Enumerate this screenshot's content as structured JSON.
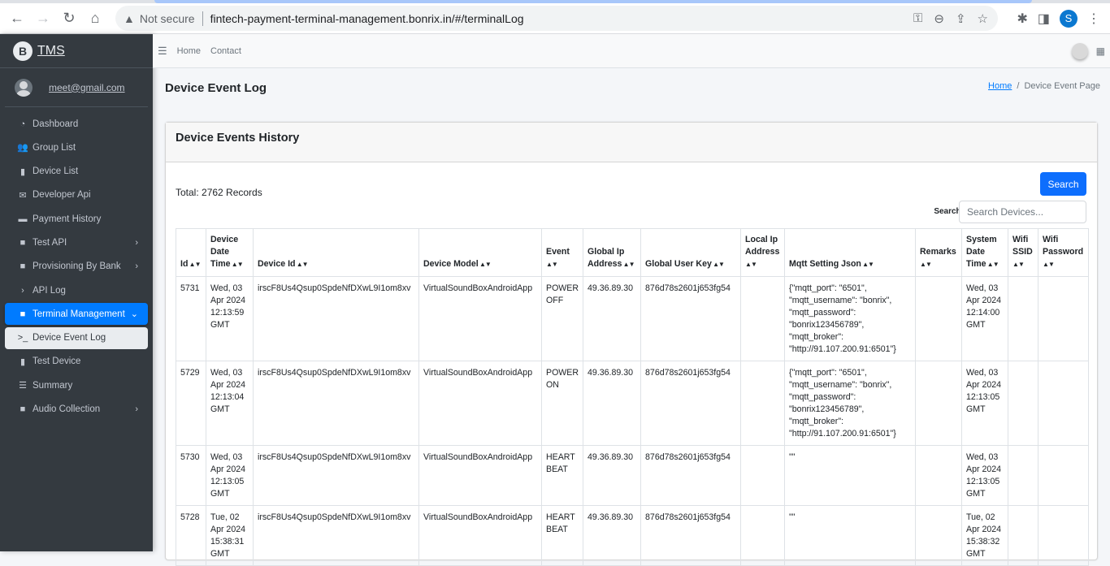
{
  "browser": {
    "not_secure_label": "Not secure",
    "url": "fintech-payment-terminal-management.bonrix.in/#/terminalLog",
    "profile_initial": "S",
    "icons": [
      "back-icon",
      "forward-icon",
      "reload-icon",
      "home-icon",
      "warning-icon",
      "key-icon",
      "zoom-out-icon",
      "share-icon",
      "star-icon",
      "extensions-icon",
      "sidepanel-icon",
      "menu-icon"
    ]
  },
  "sidebar": {
    "brand": "TMS",
    "brand_logo": "B",
    "user_email": "meet@gmail.com",
    "items": [
      {
        "label": "Dashboard",
        "icon": "tachometer-icon",
        "glyph": "◔",
        "chevron": false
      },
      {
        "label": "Group List",
        "icon": "users-icon",
        "glyph": "👥",
        "chevron": false
      },
      {
        "label": "Device List",
        "icon": "mobile-icon",
        "glyph": "▮",
        "chevron": false
      },
      {
        "label": "Developer Api",
        "icon": "envelope-open-icon",
        "glyph": "✉",
        "chevron": false
      },
      {
        "label": "Payment History",
        "icon": "credit-card-icon",
        "glyph": "▬",
        "chevron": false
      },
      {
        "label": "Test API",
        "icon": "folder-icon",
        "glyph": "■",
        "chevron": true
      },
      {
        "label": "Provisioning By Bank",
        "icon": "folder-icon",
        "glyph": "■",
        "chevron": true
      },
      {
        "label": "API Log",
        "icon": "chevron-right-icon",
        "glyph": "›",
        "chevron": false
      },
      {
        "label": "Terminal Management",
        "icon": "folder-icon",
        "glyph": "■",
        "chevron": true,
        "state": "active"
      },
      {
        "label": "Device Event Log",
        "icon": "terminal-icon",
        "glyph": ">_",
        "chevron": false,
        "state": "sub-active"
      },
      {
        "label": "Test Device",
        "icon": "mobile-icon",
        "glyph": "▮",
        "chevron": false
      },
      {
        "label": "Summary",
        "icon": "list-icon",
        "glyph": "☰",
        "chevron": false
      },
      {
        "label": "Audio Collection",
        "icon": "folder-icon",
        "glyph": "■",
        "chevron": true
      }
    ]
  },
  "topnav": {
    "links": [
      "Home",
      "Contact"
    ]
  },
  "header": {
    "title": "Device Event Log",
    "breadcrumb_home": "Home",
    "breadcrumb_current": "Device Event Page"
  },
  "card": {
    "title": "Device Events History",
    "total": "Total: 2762 Records",
    "search_button": "Search",
    "search_label": "Search:",
    "search_placeholder": "Search Devices...",
    "search_value": ""
  },
  "table": {
    "columns": [
      "Id",
      "Device Date Time",
      "Device Id",
      "Device Model",
      "Event",
      "Global Ip Address",
      "Global User Key",
      "Local Ip Address",
      "Mqtt Setting Json",
      "Remarks",
      "System Date Time",
      "Wifi SSID",
      "Wifi Password"
    ],
    "rows": [
      {
        "id": "5731",
        "device_date_time": "Wed, 03 Apr 2024 12:13:59 GMT",
        "device_id": "irscF8Us4Qsup0SpdeNfDXwL9I1om8xv",
        "device_model": "VirtualSoundBoxAndroidApp",
        "event": "POWER OFF",
        "global_ip": "49.36.89.30",
        "global_user_key": "876d78s2601j653fg54",
        "local_ip": "",
        "mqtt_json": "{\"mqtt_port\": \"6501\", \"mqtt_username\": \"bonrix\", \"mqtt_password\": \"bonrix123456789\", \"mqtt_broker\": \"http://91.107.200.91:6501\"}",
        "remarks": "",
        "system_date_time": "Wed, 03 Apr 2024 12:14:00 GMT",
        "wifi_ssid": "",
        "wifi_password": ""
      },
      {
        "id": "5729",
        "device_date_time": "Wed, 03 Apr 2024 12:13:04 GMT",
        "device_id": "irscF8Us4Qsup0SpdeNfDXwL9I1om8xv",
        "device_model": "VirtualSoundBoxAndroidApp",
        "event": "POWER ON",
        "global_ip": "49.36.89.30",
        "global_user_key": "876d78s2601j653fg54",
        "local_ip": "",
        "mqtt_json": "{\"mqtt_port\": \"6501\", \"mqtt_username\": \"bonrix\", \"mqtt_password\": \"bonrix123456789\", \"mqtt_broker\": \"http://91.107.200.91:6501\"}",
        "remarks": "",
        "system_date_time": "Wed, 03 Apr 2024 12:13:05 GMT",
        "wifi_ssid": "",
        "wifi_password": ""
      },
      {
        "id": "5730",
        "device_date_time": "Wed, 03 Apr 2024 12:13:05 GMT",
        "device_id": "irscF8Us4Qsup0SpdeNfDXwL9I1om8xv",
        "device_model": "VirtualSoundBoxAndroidApp",
        "event": "HEART BEAT",
        "global_ip": "49.36.89.30",
        "global_user_key": "876d78s2601j653fg54",
        "local_ip": "",
        "mqtt_json": "\"\"",
        "remarks": "",
        "system_date_time": "Wed, 03 Apr 2024 12:13:05 GMT",
        "wifi_ssid": "",
        "wifi_password": ""
      },
      {
        "id": "5728",
        "device_date_time": "Tue, 02 Apr 2024 15:38:31 GMT",
        "device_id": "irscF8Us4Qsup0SpdeNfDXwL9I1om8xv",
        "device_model": "VirtualSoundBoxAndroidApp",
        "event": "HEART BEAT",
        "global_ip": "49.36.89.30",
        "global_user_key": "876d78s2601j653fg54",
        "local_ip": "",
        "mqtt_json": "\"\"",
        "remarks": "",
        "system_date_time": "Tue, 02 Apr 2024 15:38:32 GMT",
        "wifi_ssid": "",
        "wifi_password": ""
      }
    ]
  },
  "colors": {
    "sidebar_bg": "#343a40",
    "active_item": "#007bff",
    "primary_button": "#0d6efd",
    "link": "#007bff"
  }
}
